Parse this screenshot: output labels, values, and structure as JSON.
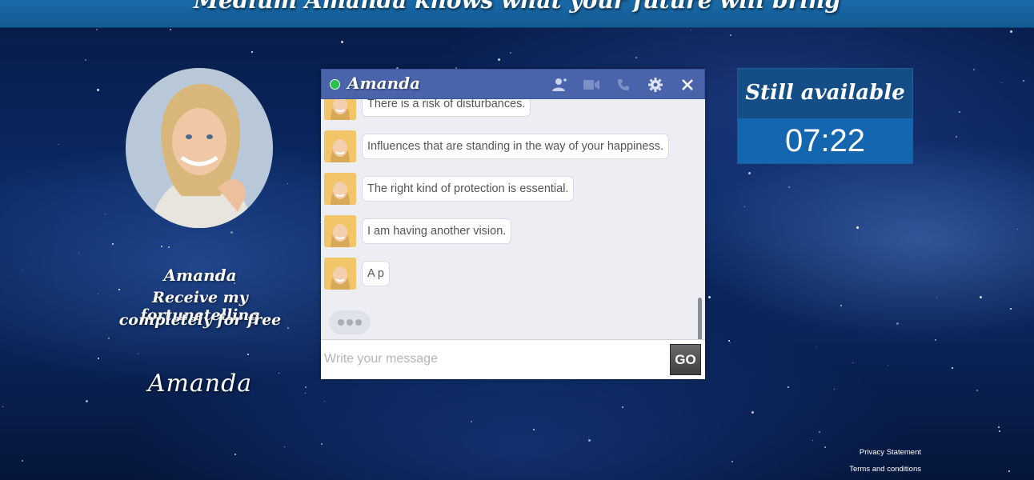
{
  "header": {
    "title": "Medium Amanda knows what your future will bring"
  },
  "profile": {
    "name": "Amanda",
    "tagline_1": "Receive my fortunetelling",
    "tagline_2": "completely for free",
    "signature": "Amanda"
  },
  "chat": {
    "title": "Amanda",
    "status_color": "#27c04a",
    "header_icons": [
      "add-user-icon",
      "video-icon",
      "phone-icon",
      "gear-icon",
      "close-icon"
    ],
    "messages": [
      "There is a risk of disturbances.",
      "Influences that are standing in the way of your happiness.",
      "The right kind of protection is essential.",
      "I am having another vision.",
      "A p"
    ],
    "input": {
      "value": "",
      "placeholder": "Write your message"
    },
    "send_label": "GO"
  },
  "timer": {
    "label": "Still available",
    "value": "07:22"
  },
  "footer": {
    "privacy": "Privacy Statement",
    "terms": "Terms and conditions"
  }
}
